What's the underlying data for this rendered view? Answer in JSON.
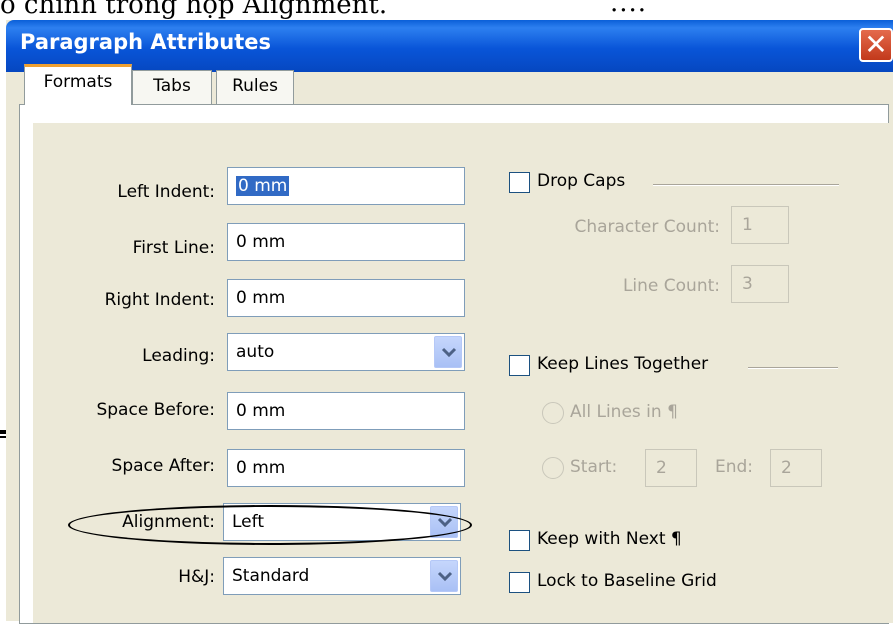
{
  "background": {
    "top_text_left": "ó chỉnh trong hộp Alignment.",
    "top_text_right": "...."
  },
  "dialog": {
    "title": "Paragraph Attributes",
    "close_glyph": "✕"
  },
  "tabs": [
    {
      "label": "Formats",
      "active": true
    },
    {
      "label": "Tabs",
      "active": false
    },
    {
      "label": "Rules",
      "active": false
    }
  ],
  "fields": {
    "left_indent": {
      "label": "Left Indent:",
      "value": "0 mm"
    },
    "first_line": {
      "label": "First Line:",
      "value": "0 mm"
    },
    "right_indent": {
      "label": "Right Indent:",
      "value": "0 mm"
    },
    "leading": {
      "label": "Leading:",
      "value": "auto"
    },
    "space_before": {
      "label": "Space Before:",
      "value": "0 mm"
    },
    "space_after": {
      "label": "Space After:",
      "value": "0 mm"
    },
    "alignment": {
      "label": "Alignment:",
      "value": "Left"
    },
    "hj": {
      "label": "H&J:",
      "value": "Standard"
    }
  },
  "drop_caps": {
    "label": "Drop Caps",
    "checked": false,
    "character_count_label": "Character Count:",
    "character_count": "1",
    "line_count_label": "Line Count:",
    "line_count": "3"
  },
  "keep_lines": {
    "label": "Keep Lines Together",
    "checked": false,
    "all_lines_label": "All Lines in ¶",
    "start_label": "Start:",
    "start_value": "2",
    "end_label": "End:",
    "end_value": "2"
  },
  "keep_with_next": {
    "label": "Keep with Next ¶",
    "checked": false
  },
  "lock_baseline": {
    "label": "Lock to Baseline Grid",
    "checked": false
  },
  "colors": {
    "titlebar": "#0A5FD8",
    "dialog_bg": "#ECE9D8",
    "selection": "#316AC5",
    "close_button": "#D2502F"
  }
}
